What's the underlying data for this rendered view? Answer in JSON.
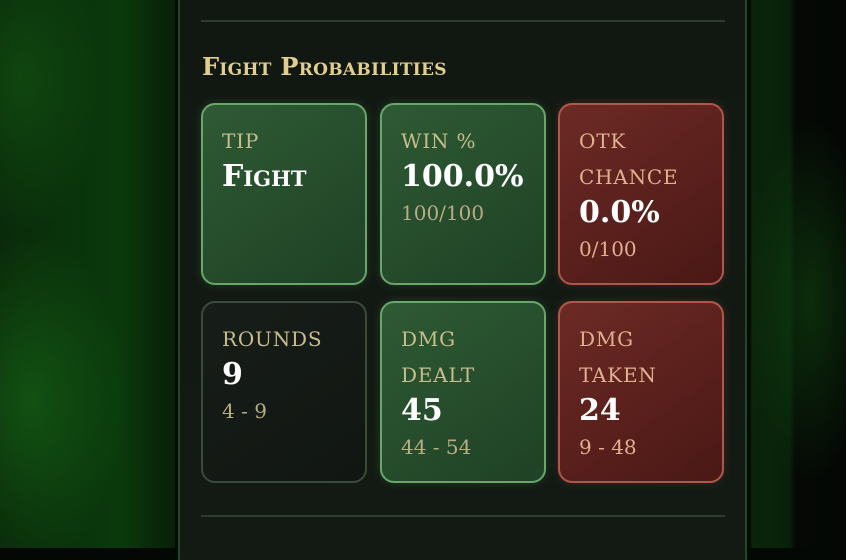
{
  "section": {
    "title": "Fight Probabilities"
  },
  "cards": [
    {
      "label": "TIP",
      "value": "Fight",
      "sub": ""
    },
    {
      "label": "WIN %",
      "value": "100.0%",
      "sub": "100/100"
    },
    {
      "label": "OTK CHANCE",
      "value": "0.0%",
      "sub": "0/100"
    },
    {
      "label": "ROUNDS",
      "value": "9",
      "sub": "4 - 9"
    },
    {
      "label": "DMG DEALT",
      "value": "45",
      "sub": "44 - 54"
    },
    {
      "label": "DMG TAKEN",
      "value": "24",
      "sub": "9 - 48"
    }
  ],
  "colors": {
    "title": "#e2cf8f",
    "green_card": "#2e5a34",
    "red_card": "#6d2a25",
    "neutral_card": "#171d18"
  }
}
